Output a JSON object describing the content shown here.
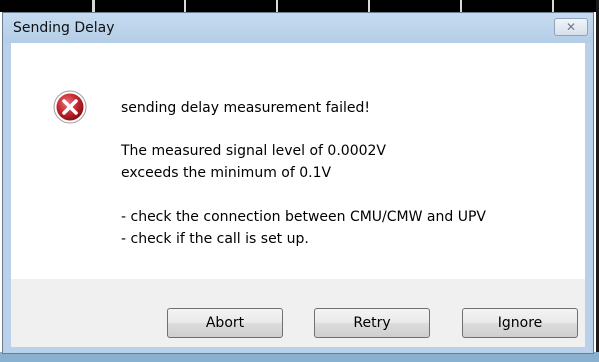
{
  "window": {
    "title": "Sending Delay",
    "close_glyph": "✕"
  },
  "message": {
    "icon": "error-icon",
    "headline": "sending delay measurement failed!",
    "detail_lines": [
      "The measured signal level of 0.0002V",
      "exceeds the minimum of 0.1V"
    ],
    "hint_lines": [
      "- check the connection between CMU/CMW and UPV",
      "- check if the call is set up."
    ]
  },
  "buttons": {
    "abort": "Abort",
    "retry": "Retry",
    "ignore": "Ignore"
  },
  "colors": {
    "frame": "#b9d1ea",
    "error_red": "#c1272d"
  }
}
